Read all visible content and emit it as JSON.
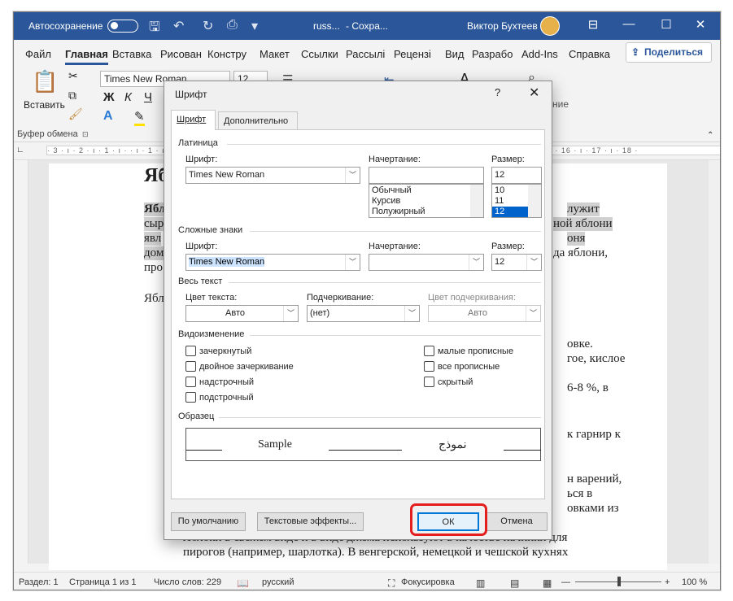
{
  "titlebar": {
    "autosave": "Автосохранение",
    "doc": "russ...",
    "saving": "- Сохра...",
    "user": "Виктор Бухтеев"
  },
  "tabs": [
    "Файл",
    "Главная",
    "Вставка",
    "Рисован",
    "Констру",
    "Макет",
    "Ссылки",
    "Рассылі",
    "Рецензі",
    "Вид",
    "Разрабо",
    "Add-Ins",
    "Справка"
  ],
  "share": "Поделиться",
  "ribbon": {
    "paste": "Вставить",
    "clipboard": "Буфер обмена",
    "font": "Times New Roman",
    "size": "12",
    "bold": "Ж",
    "italic": "К",
    "underline": "Ч",
    "right_label": "ние"
  },
  "document": {
    "lines": [
      "Ябл",
      "Ябл",
      "сыр",
      "явл",
      "дом",
      "про",
      "Ябл"
    ],
    "right": [
      "лужит",
      "ной яблони",
      "оня",
      "да яблони,",
      "овке.",
      "гое, кислое",
      "6-8 %, в",
      "к гарнир к",
      "н варений,",
      "ься в",
      "овками из"
    ],
    "bullet1": "Яблоки в свежем виде и в виде джема используют в качестве начинки для",
    "bullet2": "пирогов (например, шарлотка). В венгерской, немецкой и чешской кухнях"
  },
  "status": {
    "section": "Раздел: 1",
    "page": "Страница 1 из 1",
    "words": "Число слов: 229",
    "lang": "русский",
    "focus": "Фокусировка",
    "zoom": "100 %"
  },
  "dialog": {
    "title": "Шрифт",
    "help": "?",
    "close": "✕",
    "tab_font": "Шрифт",
    "tab_adv": "Дополнительно",
    "latin": "Латиница",
    "font_label": "Шрифт:",
    "style_label": "Начертание:",
    "size_label": "Размер:",
    "latin_font": "Times New Roman",
    "latin_size": "12",
    "styles": [
      "Обычный",
      "Курсив",
      "Полужирный"
    ],
    "sizes": [
      "10",
      "11",
      "12"
    ],
    "complex": "Сложные знаки",
    "complex_font": "Times New Roman",
    "complex_size": "12",
    "all_text": "Весь текст",
    "color_label": "Цвет текста:",
    "color_value": "Авто",
    "underline_label": "Подчеркивание:",
    "underline_value": "(нет)",
    "ucolor_label": "Цвет подчеркивания:",
    "ucolor_value": "Авто",
    "effects": "Видоизменение",
    "cb": [
      "зачеркнутый",
      "двойное зачеркивание",
      "надстрочный",
      "подстрочный",
      "малые прописные",
      "все прописные",
      "скрытый"
    ],
    "sample_title": "Образец",
    "sample_text": "Sample",
    "sample_arabic": "نموذج",
    "btn_default": "По умолчанию",
    "btn_effects": "Текстовые эффекты...",
    "btn_ok": "ОК",
    "btn_cancel": "Отмена"
  }
}
